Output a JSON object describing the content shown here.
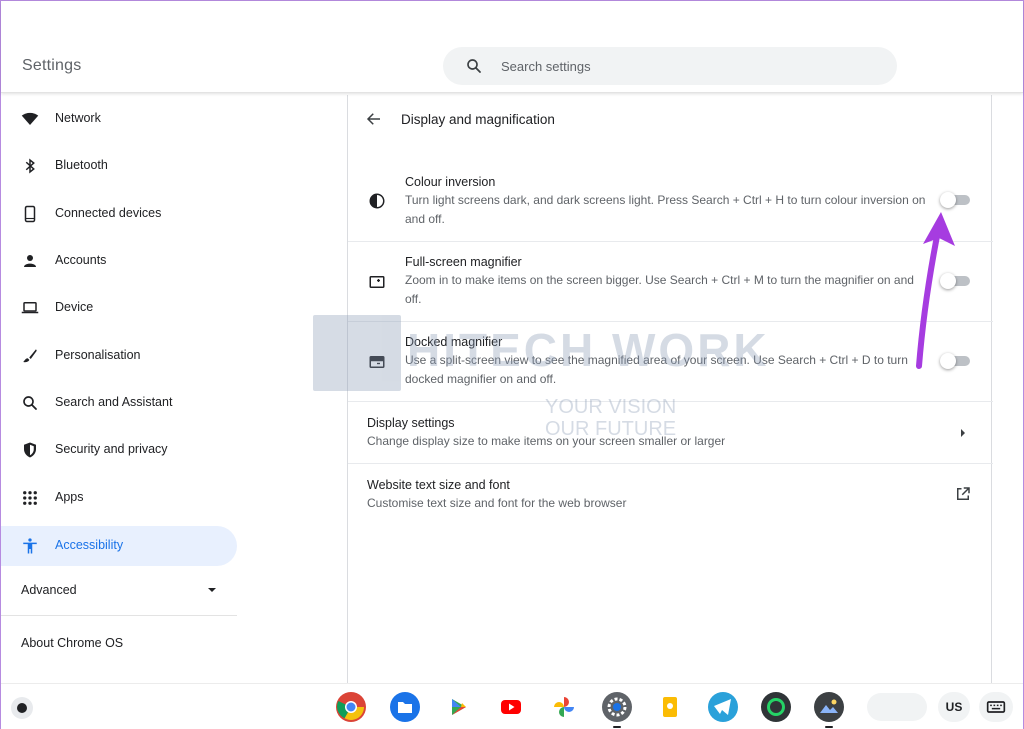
{
  "header": {
    "title": "Settings",
    "search_placeholder": "Search settings"
  },
  "sidebar": {
    "items": [
      {
        "label": "Network",
        "icon": "wifi-icon"
      },
      {
        "label": "Bluetooth",
        "icon": "bluetooth-icon"
      },
      {
        "label": "Connected devices",
        "icon": "phone-icon"
      },
      {
        "label": "Accounts",
        "icon": "person-icon"
      },
      {
        "label": "Device",
        "icon": "laptop-icon"
      },
      {
        "label": "Personalisation",
        "icon": "brush-icon"
      },
      {
        "label": "Search and Assistant",
        "icon": "search-icon"
      },
      {
        "label": "Security and privacy",
        "icon": "shield-icon"
      },
      {
        "label": "Apps",
        "icon": "apps-grid-icon"
      },
      {
        "label": "Accessibility",
        "icon": "accessibility-icon",
        "active": true
      }
    ],
    "advanced_label": "Advanced",
    "about_label": "About Chrome OS"
  },
  "main": {
    "title": "Display and magnification",
    "rows": [
      {
        "title": "Colour inversion",
        "description": "Turn light screens dark, and dark screens light. Press Search + Ctrl + H to turn colour inversion on and off.",
        "icon": "contrast-icon",
        "control": "toggle",
        "enabled": false
      },
      {
        "title": "Full-screen magnifier",
        "description": "Zoom in to make items on the screen bigger. Use Search + Ctrl + M to turn the magnifier on and off.",
        "icon": "fullscreen-magnifier-icon",
        "control": "toggle",
        "enabled": false
      },
      {
        "title": "Docked magnifier",
        "description": "Use a split-screen view to see the magnified area of your screen. Use Search + Ctrl + D to turn docked magnifier on and off.",
        "icon": "docked-magnifier-icon",
        "control": "toggle",
        "enabled": false
      },
      {
        "title": "Display settings",
        "description": "Change display size to make items on your screen smaller or larger",
        "control": "chevron"
      },
      {
        "title": "Website text size and font",
        "description": "Customise text size and font for the web browser",
        "control": "external-link"
      }
    ]
  },
  "watermark": {
    "brand": "HITECH WORK",
    "tagline_1": "YOUR VISION",
    "tagline_2": "OUR FUTURE"
  },
  "shelf": {
    "apps": [
      "chrome-icon",
      "files-icon",
      "play-store-icon",
      "youtube-icon",
      "photos-icon",
      "settings-icon",
      "keep-icon",
      "telegram-icon",
      "whatsapp-icon",
      "gallery-icon"
    ],
    "ime_label": "US"
  },
  "colors": {
    "accent": "#1a73e8",
    "active_bg": "#e8f0fe",
    "annotation_arrow": "#a63ce0"
  }
}
